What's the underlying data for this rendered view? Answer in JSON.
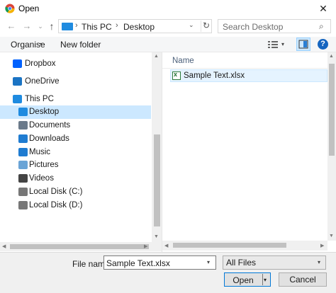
{
  "window": {
    "title": "Open",
    "close_glyph": "✕"
  },
  "address": {
    "breadcrumbs": [
      "This PC",
      "Desktop"
    ],
    "separator": "›",
    "dropdown_glyph": "⌄",
    "refresh_glyph": "↻"
  },
  "nav_buttons": {
    "back": "←",
    "forward": "→",
    "recent": "⌄",
    "up": "↑"
  },
  "search": {
    "placeholder": "Search Desktop",
    "icon": "⌕"
  },
  "toolbar": {
    "organise_label": "Organise",
    "new_folder_label": "New folder",
    "caret": "▾",
    "help_label": "?"
  },
  "sidebar": {
    "items": [
      {
        "label": "Dropbox",
        "icon": "dropbox-icon",
        "color": "#0061fe",
        "indent": 0
      },
      {
        "label": "OneDrive",
        "icon": "cloud-icon",
        "color": "#1b74c4",
        "indent": 0
      },
      {
        "label": "This PC",
        "icon": "computer-icon",
        "color": "#1f8be0",
        "indent": 0
      },
      {
        "label": "Desktop",
        "icon": "desktop-icon",
        "color": "#1f8be0",
        "indent": 1,
        "selected": true
      },
      {
        "label": "Documents",
        "icon": "documents-icon",
        "color": "#6b7a8a",
        "indent": 1
      },
      {
        "label": "Downloads",
        "icon": "download-arrow-icon",
        "color": "#1f7cd1",
        "indent": 1
      },
      {
        "label": "Music",
        "icon": "music-note-icon",
        "color": "#1f7cd1",
        "indent": 1
      },
      {
        "label": "Pictures",
        "icon": "pictures-icon",
        "color": "#6aa4d6",
        "indent": 1
      },
      {
        "label": "Videos",
        "icon": "videos-icon",
        "color": "#444444",
        "indent": 1
      },
      {
        "label": "Local Disk (C:)",
        "icon": "drive-icon",
        "color": "#777777",
        "indent": 1
      },
      {
        "label": "Local Disk (D:)",
        "icon": "drive-icon",
        "color": "#777777",
        "indent": 1
      }
    ]
  },
  "files": {
    "column_name": "Name",
    "items": [
      {
        "name": "Sample Text.xlsx",
        "icon": "excel-file-icon",
        "selected": true,
        "badge": "x"
      }
    ]
  },
  "scroll_arrows": {
    "up": "▲",
    "down": "▼",
    "left": "◀",
    "right": "▶"
  },
  "footer": {
    "file_name_label": "File name:",
    "file_name_value": "Sample Text.xlsx",
    "file_type_value": "All Files",
    "open_label": "Open",
    "cancel_label": "Cancel",
    "caret": "▾"
  }
}
